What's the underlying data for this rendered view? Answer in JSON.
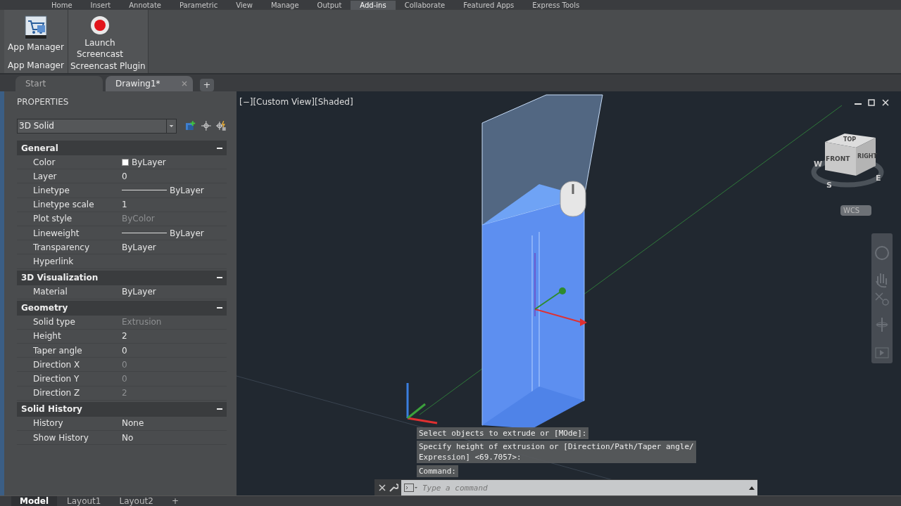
{
  "ribbon_tabs": [
    {
      "label": "Home",
      "selected": false
    },
    {
      "label": "Insert",
      "selected": false
    },
    {
      "label": "Annotate",
      "selected": false
    },
    {
      "label": "Parametric",
      "selected": false
    },
    {
      "label": "View",
      "selected": false
    },
    {
      "label": "Manage",
      "selected": false
    },
    {
      "label": "Output",
      "selected": false
    },
    {
      "label": "Add-ins",
      "selected": true
    },
    {
      "label": "Collaborate",
      "selected": false
    },
    {
      "label": "Featured Apps",
      "selected": false
    },
    {
      "label": "Express Tools",
      "selected": false
    }
  ],
  "ribbon_panels": [
    {
      "title": "App Manager",
      "buttons": [
        {
          "label": "App Manager",
          "kind": "app"
        }
      ]
    },
    {
      "title": "Screencast Plugin",
      "buttons": [
        {
          "label": "Launch Screencast",
          "kind": "record"
        }
      ]
    }
  ],
  "doc_tabs": [
    {
      "label": "Start",
      "selected": false,
      "closable": false
    },
    {
      "label": "Drawing1*",
      "selected": true,
      "closable": true
    }
  ],
  "new_tab": "+",
  "properties": {
    "title": "PROPERTIES",
    "object_type": "3D Solid",
    "sections": [
      {
        "title": "General",
        "expanded": true,
        "rows": [
          {
            "label": "Color",
            "value": "ByLayer",
            "kind": "swatch",
            "disabled": false
          },
          {
            "label": "Layer",
            "value": "0",
            "kind": "text",
            "disabled": false
          },
          {
            "label": "Linetype",
            "value": "ByLayer",
            "kind": "line",
            "disabled": false
          },
          {
            "label": "Linetype scale",
            "value": "1",
            "kind": "text",
            "disabled": false
          },
          {
            "label": "Plot style",
            "value": "ByColor",
            "kind": "text",
            "disabled": true
          },
          {
            "label": "Lineweight",
            "value": "ByLayer",
            "kind": "line",
            "disabled": false
          },
          {
            "label": "Transparency",
            "value": "ByLayer",
            "kind": "text",
            "disabled": false
          },
          {
            "label": "Hyperlink",
            "disabled": false
          }
        ]
      },
      {
        "title": "3D Visualization",
        "expanded": true,
        "rows": [
          {
            "label": "Material",
            "value": "ByLayer",
            "kind": "text",
            "disabled": false
          }
        ]
      },
      {
        "title": "Geometry",
        "expanded": true,
        "rows": [
          {
            "label": "Solid type",
            "value": "Extrusion",
            "kind": "text",
            "disabled": true
          },
          {
            "label": "Height",
            "value": "2",
            "kind": "text",
            "disabled": false
          },
          {
            "label": "Taper angle",
            "value": "0",
            "kind": "text",
            "disabled": false
          },
          {
            "label": "Direction X",
            "value": "0",
            "kind": "text",
            "disabled": true
          },
          {
            "label": "Direction Y",
            "value": "0",
            "kind": "text",
            "disabled": true
          },
          {
            "label": "Direction Z",
            "value": "2",
            "kind": "text",
            "disabled": true
          }
        ]
      },
      {
        "title": "Solid History",
        "expanded": true,
        "rows": [
          {
            "label": "History",
            "value": "None",
            "kind": "text",
            "disabled": false
          },
          {
            "label": "Show History",
            "value": "No",
            "kind": "text",
            "disabled": false
          }
        ]
      }
    ]
  },
  "viewport": {
    "label": "[−][Custom View][Shaded]",
    "viewcube": {
      "faces": [
        "FRONT",
        "RIGHT",
        "TOP"
      ],
      "compass": [
        "W",
        "S",
        "E"
      ],
      "ucs": "WCS"
    },
    "command_history": [
      "Select objects to extrude or [MOde]:",
      "Specify height of extrusion or [Direction/Path/Taper angle/\nExpression] <69.7057>:",
      "Command:"
    ],
    "command_input": {
      "placeholder": "Type a command"
    }
  },
  "layout_tabs": [
    {
      "label": "Model",
      "selected": true
    },
    {
      "label": "Layout1",
      "selected": false
    },
    {
      "label": "Layout2",
      "selected": false
    }
  ],
  "new_layout": "+"
}
